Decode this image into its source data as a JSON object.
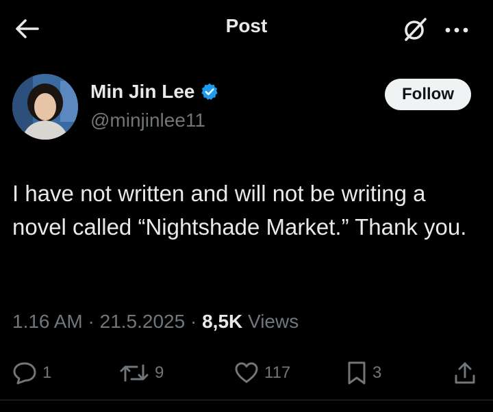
{
  "topbar": {
    "title": "Post"
  },
  "author": {
    "name": "Min Jin Lee",
    "handle": "@minjinlee11",
    "verified": true,
    "follow_label": "Follow"
  },
  "post": {
    "text": "I have not written and will not be writing a novel called “Nightshade Market.” Thank you."
  },
  "meta": {
    "time": "1.16 AM",
    "date": "21.5.2025",
    "views_count": "8,5K",
    "views_label": "Views",
    "sep": "·"
  },
  "actions": {
    "replies": "1",
    "reposts": "9",
    "likes": "117",
    "bookmarks": "3"
  },
  "colors": {
    "background": "#000000",
    "text": "#e7e9ea",
    "muted": "#71767b",
    "verified": "#1d9bf0"
  },
  "icons": [
    "back-arrow-icon",
    "grok-icon",
    "more-icon",
    "verified-badge-icon",
    "reply-icon",
    "repost-icon",
    "like-icon",
    "bookmark-icon",
    "share-icon"
  ]
}
